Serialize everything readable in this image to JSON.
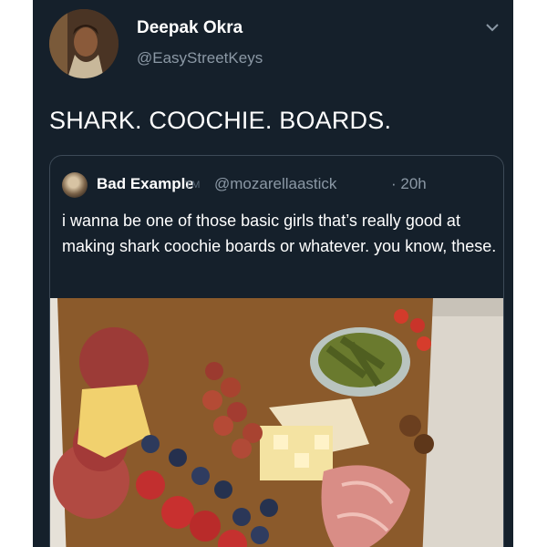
{
  "tweet": {
    "display_name": "Deepak Okra",
    "handle": "@EasyStreetKeys",
    "text": "SHARK. COOCHIE. BOARDS."
  },
  "quoted_tweet": {
    "display_name": "Bad Example",
    "name_suffix": "TM",
    "handle": "@mozarellaastick",
    "time": "· 20h",
    "text": "i wanna be one of those basic girls that’s really good at making shark coochie boards or whatever. you know, these."
  },
  "icons": {
    "author_avatar": "avatar-photo",
    "menu": "chevron-down-icon",
    "quoted_avatar": "avatar-photo"
  },
  "colors": {
    "background": "#15202b",
    "primary_text": "#ffffff",
    "secondary_text": "#8b98a5",
    "border": "#3d4a57"
  }
}
